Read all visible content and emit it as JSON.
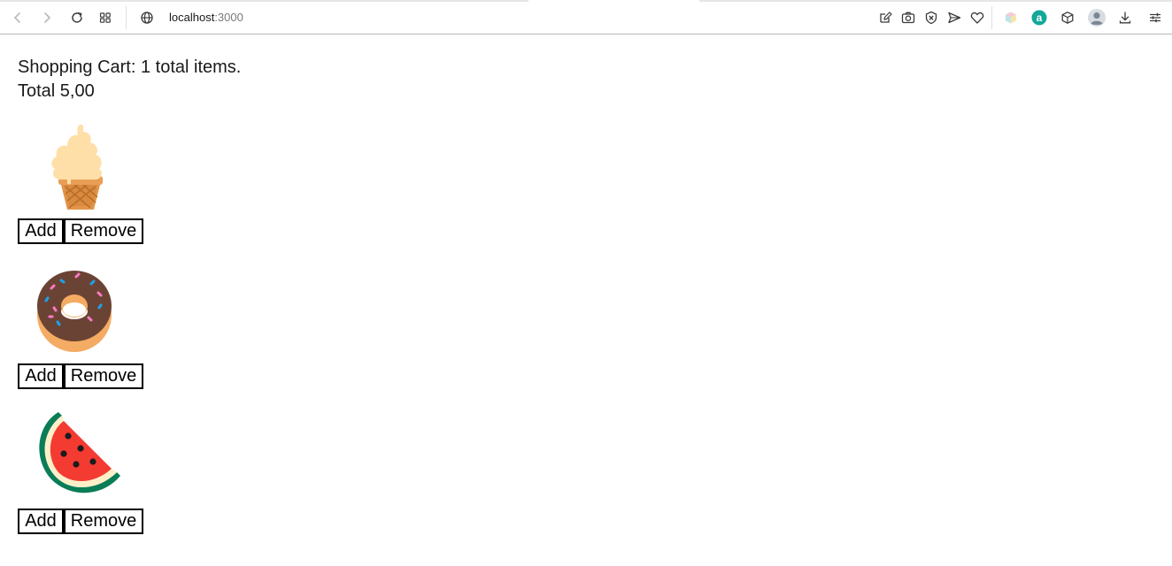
{
  "browser": {
    "address_host": "localhost",
    "address_port": ":3000",
    "icons": [
      "back-icon",
      "forward-icon",
      "reload-icon",
      "tab-grid-icon",
      "globe-icon",
      "edit-page-icon",
      "camera-icon",
      "shield-block-icon",
      "send-icon",
      "heart-icon",
      "cube-extension-icon",
      "a-extension-icon",
      "box-icon",
      "profile-avatar-icon",
      "download-icon",
      "settings-sliders-icon"
    ]
  },
  "cart": {
    "summary_line": "Shopping Cart: 1 total items.",
    "total_line": "Total 5,00"
  },
  "products": [
    {
      "name": "ice-cream",
      "icon": "ice-cream-icon",
      "add_label": "Add",
      "remove_label": "Remove"
    },
    {
      "name": "donut",
      "icon": "donut-icon",
      "add_label": "Add",
      "remove_label": "Remove"
    },
    {
      "name": "watermelon",
      "icon": "watermelon-icon",
      "add_label": "Add",
      "remove_label": "Remove"
    }
  ],
  "colors": {
    "ice_cream": "#FFDFA8",
    "cone": "#E2954A",
    "donut_glaze": "#6B4334",
    "donut_dough": "#F4AB63",
    "watermelon_flesh": "#F33B32",
    "watermelon_rind": "#0A7D57",
    "button_border": "#000000"
  }
}
